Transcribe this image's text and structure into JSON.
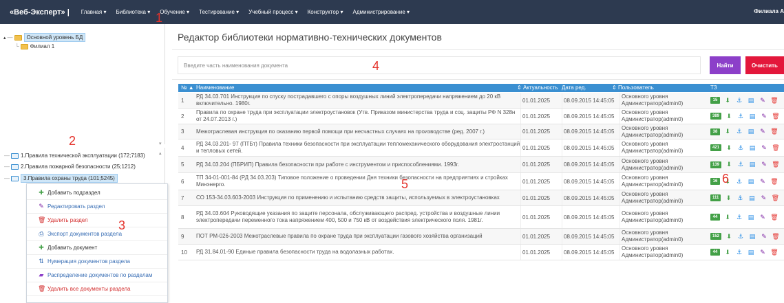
{
  "navbar": {
    "brand": "«Веб-Эксперт» |",
    "menu": [
      "Главная ▾",
      "Библиотека ▾",
      "Обучение ▾",
      "Тестирование ▾",
      "Учебный процесс ▾",
      "Конструктор ▾",
      "Администрирование ▾"
    ],
    "user": "Филиала А"
  },
  "tree_top": {
    "root": "Основной уровень БД",
    "child": "Филиал 1"
  },
  "tree_bottom": {
    "items": [
      "1.Правила технической эксплуатации (172;7183)",
      "2.Правила пожарной безопасности (25;1212)",
      "3.Правила охраны труда (101;5245)"
    ]
  },
  "context_menu": {
    "items": [
      {
        "label": "Добавить подраздел",
        "icon": "plus-icon",
        "color": "#333333"
      },
      {
        "label": "Редактировать раздел",
        "icon": "edit-icon",
        "color": "#3a6fb5"
      },
      {
        "label": "Удалить раздел",
        "icon": "trash-icon",
        "color": "#d32f2f"
      },
      {
        "label": "Экспорт документов раздела",
        "icon": "export-icon",
        "color": "#3a6fb5"
      },
      {
        "label": "Добавить документ",
        "icon": "plus-icon",
        "color": "#333333"
      },
      {
        "label": "Нумерация документов раздела",
        "icon": "sort-icon",
        "color": "#3a6fb5"
      },
      {
        "label": "Распределение документов по разделам",
        "icon": "folders-icon",
        "color": "#3a6fb5"
      },
      {
        "label": "Удалить все документы раздела",
        "icon": "trash-icon",
        "color": "#d32f2f"
      }
    ]
  },
  "page": {
    "title": "Редактор библиотеки нормативно-технических документов"
  },
  "search": {
    "placeholder": "Введите часть наименования документа",
    "find_label": "Найти",
    "clear_label": "Очистить"
  },
  "table": {
    "headers": {
      "num": "№ ▲",
      "name": "Наименование",
      "actual": "Актуальность",
      "date": "Дата ред.",
      "user": "Пользователь",
      "tz": "ТЗ"
    },
    "rows": [
      {
        "num": "1",
        "name": "РД 34.03.701 Инструкция по спуску пострадавшего с опоры воздушных линий электропередачи напряжением до 20 кВ включительно. 1980г.",
        "actual": "01.01.2025",
        "date": "08.09.2015 14:45:05",
        "user": "Основного уровня Администратор(admin0)",
        "tz": "15"
      },
      {
        "num": "2",
        "name": "Правила по охране труда при эксплуатации электроустановок (Утв. Приказом министерства труда и соц. защиты РФ N 328н от 24.07.2013 г.)",
        "actual": "01.01.2025",
        "date": "08.09.2015 14:45:05",
        "user": "Основного уровня Администратор(admin0)",
        "tz": "389"
      },
      {
        "num": "3",
        "name": "Межотраслевая инструкция по оказанию первой помощи при несчастных случаях на производстве (ред. 2007 г.)",
        "actual": "01.01.2025",
        "date": "08.09.2015 14:45:05",
        "user": "Основного уровня Администратор(admin0)",
        "tz": "38"
      },
      {
        "num": "4",
        "name": "РД 34.03.201- 97 (ПТБт) Правила техники безопасности при эксплуатации тепломеханического оборудования электростанций и тепловых сетей.",
        "actual": "01.01.2025",
        "date": "08.09.2015 14:45:05",
        "user": "Основного уровня Администратор(admin0)",
        "tz": "421"
      },
      {
        "num": "5",
        "name": "РД 34.03.204 (ПБРИП) Правила безопасности при работе с инструментом и приспособлениями. 1993г.",
        "actual": "01.01.2025",
        "date": "08.09.2015 14:45:05",
        "user": "Основного уровня Администратор(admin0)",
        "tz": "139"
      },
      {
        "num": "6",
        "name": "ТП 34-01-001-84 (РД 34.03.203) Типовое положение о проведении Дня техники безопасности на предприятиях и стройках Минэнерго.",
        "actual": "01.01.2025",
        "date": "08.09.2015 14:45:05",
        "user": "Основного уровня Администратор(admin0)",
        "tz": "16"
      },
      {
        "num": "7",
        "name": "СО 153-34.03.603-2003 Инструкция по применению и испытанию средств защиты, используемых в электроустановках",
        "actual": "01.01.2025",
        "date": "08.09.2015 14:45:05",
        "user": "Основного уровня Администратор(admin0)",
        "tz": "111"
      },
      {
        "num": "8",
        "name": "РД 34.03.604 Руководящие указания по защите персонала, обслуживающего распред. устройства и воздушные линии электропередачи переменного тока напряжением 400, 500 и 750 кВ от воздействия электрического поля. 1981г.",
        "actual": "01.01.2025",
        "date": "08.09.2015 14:45:05",
        "user": "Основного уровня Администратор(admin0)",
        "tz": "44"
      },
      {
        "num": "9",
        "name": "ПОТ РМ-026-2003 Межотраслевые правила по охране труда при эксплуатации газового хозяйства организаций",
        "actual": "01.01.2025",
        "date": "08.09.2015 14:45:05",
        "user": "Основного уровня Администратор(admin0)",
        "tz": "152"
      },
      {
        "num": "10",
        "name": "РД 31.84.01-90 Единые правила безопасности труда на водолазных работах.",
        "actual": "01.01.2025",
        "date": "08.09.2015 14:45:05",
        "user": "Основного уровня Администратор(admin0)",
        "tz": "44"
      }
    ]
  },
  "annotations": [
    "1",
    "2",
    "3",
    "4",
    "5",
    "6"
  ],
  "colors": {
    "navbar": "#2d3a50",
    "accent_blue": "#3a8fd1",
    "find": "#8c3fc9",
    "clear": "#e3173b",
    "badge": "#43a047"
  }
}
